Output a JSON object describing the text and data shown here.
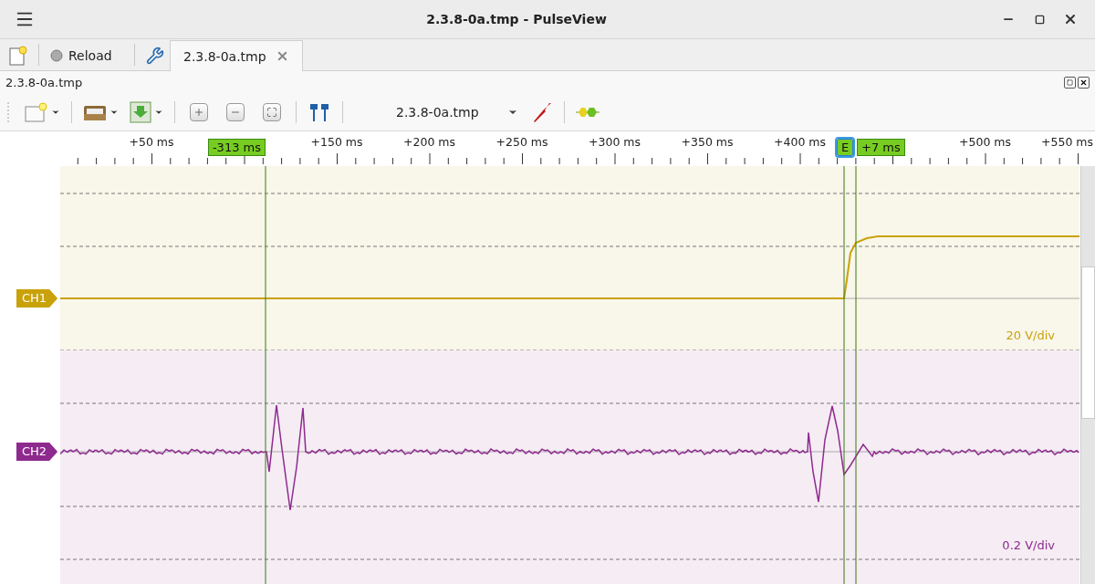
{
  "window": {
    "title": "2.3.8-0a.tmp - PulseView"
  },
  "tab_bar": {
    "reload": "Reload",
    "tabs": [
      {
        "label": "2.3.8-0a.tmp",
        "selected": true
      }
    ]
  },
  "dock": {
    "title": "2.3.8-0a.tmp"
  },
  "toolbar": {
    "device": "2.3.8-0a.tmp"
  },
  "ruler": {
    "labels": [
      "+50 ms",
      "+150 ms",
      "+200 ms",
      "+250 ms",
      "+300 ms",
      "+350 ms",
      "+400 ms",
      "+500 ms",
      "+550 ms"
    ]
  },
  "markers": [
    {
      "label": "-313 ms",
      "kind": "cursor"
    },
    {
      "label": "E",
      "kind": "trigger"
    },
    {
      "label": "+7 ms",
      "kind": "cursor"
    }
  ],
  "channels": [
    {
      "name": "CH1",
      "color": "#c9a20a",
      "scale": "20 V/div"
    },
    {
      "name": "CH2",
      "color": "#8e2a8e",
      "scale": "0.2 V/div"
    }
  ]
}
